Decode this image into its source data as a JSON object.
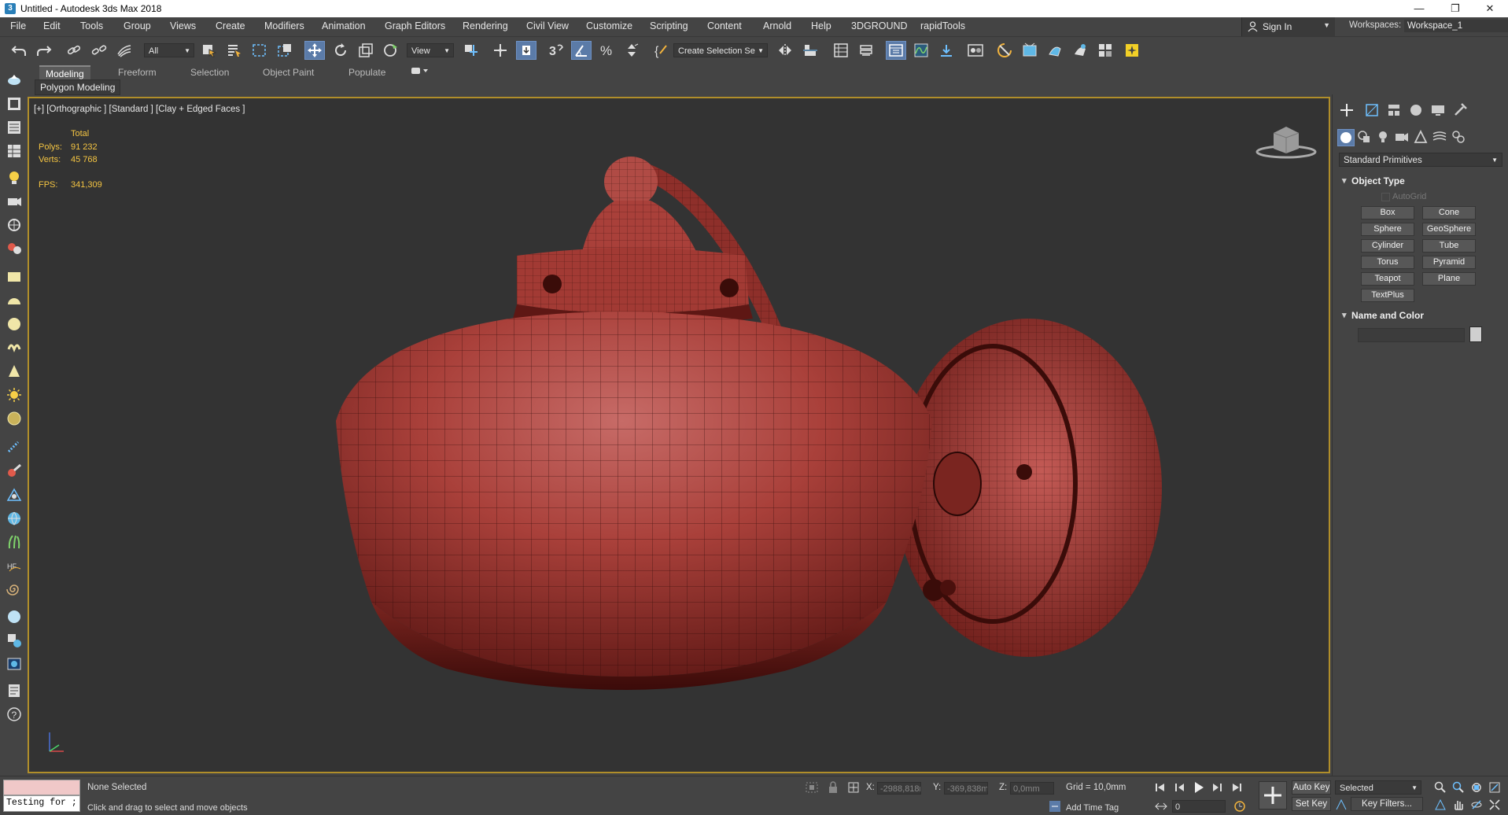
{
  "window": {
    "title": "Untitled - Autodesk 3ds Max 2018",
    "app_icon": "3ds-max-icon",
    "controls": [
      "minimize-icon",
      "restore-icon",
      "close-icon"
    ]
  },
  "menubar": {
    "items": [
      "File",
      "Edit",
      "Tools",
      "Group",
      "Views",
      "Create",
      "Modifiers",
      "Animation",
      "Graph Editors",
      "Rendering",
      "Civil View",
      "Customize",
      "Scripting",
      "Content",
      "Arnold",
      "Help",
      "3DGROUND",
      "rapidTools"
    ],
    "sign_in": "Sign In",
    "workspaces_label": "Workspaces:",
    "workspace_value": "Workspace_1"
  },
  "toolbar": {
    "selection_filter": "All",
    "ref_coord": "View",
    "named_selection": "Create Selection Se"
  },
  "ribbon": {
    "tabs": [
      "Modeling",
      "Freeform",
      "Selection",
      "Object Paint",
      "Populate"
    ],
    "active_tab": "Modeling",
    "panel_label": "Polygon Modeling"
  },
  "viewport": {
    "label": "[+] [Orthographic ] [Standard ] [Clay + Edged Faces ]",
    "stats": {
      "total_label": "Total",
      "polys_label": "Polys:",
      "polys_value": "91 232",
      "verts_label": "Verts:",
      "verts_value": "45 768",
      "fps_label": "FPS:",
      "fps_value": "341,309"
    },
    "model_color": "#b3423c",
    "border_color": "#b08e2a"
  },
  "command_panel": {
    "category": "Standard Primitives",
    "object_type_title": "Object Type",
    "autogrid": "AutoGrid",
    "primitives": [
      "Box",
      "Cone",
      "Sphere",
      "GeoSphere",
      "Cylinder",
      "Tube",
      "Torus",
      "Pyramid",
      "Teapot",
      "Plane",
      "TextPlus"
    ],
    "name_color_title": "Name and Color"
  },
  "status": {
    "maxscript_text": "Testing for ;",
    "selection_status": "None Selected",
    "prompt": "Click and drag to select and move objects",
    "x_label": "X:",
    "x_value": "-2988,818r",
    "y_label": "Y:",
    "y_value": "-369,838m",
    "z_label": "Z:",
    "z_value": "0,0mm",
    "grid": "Grid = 10,0mm",
    "add_time_tag": "Add Time Tag",
    "auto_key": "Auto Key",
    "set_key": "Set Key",
    "selected_dd": "Selected",
    "key_filters": "Key Filters...",
    "frame": "0"
  }
}
